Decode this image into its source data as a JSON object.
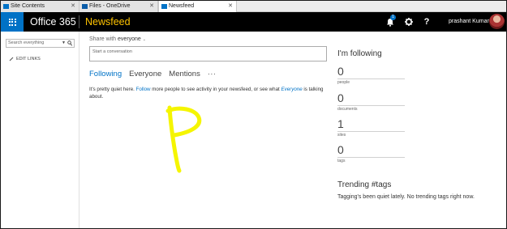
{
  "browser": {
    "tabs": [
      {
        "label": "Site Contents",
        "active": false
      },
      {
        "label": "Files - OneDrive",
        "active": false
      },
      {
        "label": "Newsfeed",
        "active": true
      }
    ]
  },
  "suitebar": {
    "brand": "Office 365",
    "app": "Newsfeed",
    "notification_count": "1",
    "username": "prashant Kumar"
  },
  "leftnav": {
    "search_placeholder": "Search everything",
    "edit_links": "EDIT LINKS"
  },
  "main": {
    "share_prefix": "Share with",
    "share_target": "everyone",
    "conversation_placeholder": "Start a conversation",
    "tabs": {
      "following": "Following",
      "everyone": "Everyone",
      "mentions": "Mentions",
      "more": "···"
    },
    "quiet": {
      "part1": "It's pretty quiet here.",
      "follow_link": "Follow",
      "part2": "more people to see activity in your newsfeed, or see what",
      "everyone_link": "Everyone",
      "part3": "is talking about."
    }
  },
  "right": {
    "heading": "I'm following",
    "stats": [
      {
        "value": "0",
        "label": "people"
      },
      {
        "value": "0",
        "label": "documents"
      },
      {
        "value": "1",
        "label": "sites"
      },
      {
        "value": "0",
        "label": "tags"
      }
    ],
    "trending_heading": "Trending #tags",
    "trending_text": "Tagging's been quiet lately. No trending tags right now."
  },
  "colors": {
    "accent": "#0072c6",
    "app_name": "#ffc400",
    "annotation": "#f5f500"
  }
}
